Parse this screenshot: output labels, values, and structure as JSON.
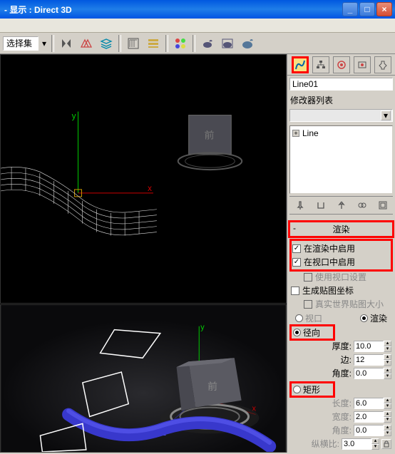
{
  "titlebar": {
    "title": "- 显示 : Direct 3D",
    "min": "_",
    "max": "□",
    "close": "×"
  },
  "toolbar": {
    "select_set": "选择集"
  },
  "side": {
    "object_name": "Line01",
    "modifier_label": "修改器列表",
    "stack_item": "Line"
  },
  "rollouts": {
    "render": {
      "title": "渲染",
      "enable_in_render": "在渲染中启用",
      "enable_in_viewport": "在视口中启用",
      "use_viewport_settings": "使用视口设置",
      "generate_mapping": "生成贴图坐标",
      "real_world_map": "真实世界贴图大小",
      "viewport": "视口",
      "render_radio": "渲染",
      "radial": "径向",
      "thickness": "厚度:",
      "thickness_val": "10.0",
      "sides": "边:",
      "sides_val": "12",
      "angle": "角度:",
      "angle_val": "0.0",
      "rectangular": "矩形",
      "length": "长度:",
      "length_val": "6.0",
      "width": "宽度:",
      "width_val": "2.0",
      "rect_angle": "角度:",
      "rect_angle_val": "0.0",
      "aspect": "纵横比:",
      "aspect_val": "3.0"
    }
  }
}
